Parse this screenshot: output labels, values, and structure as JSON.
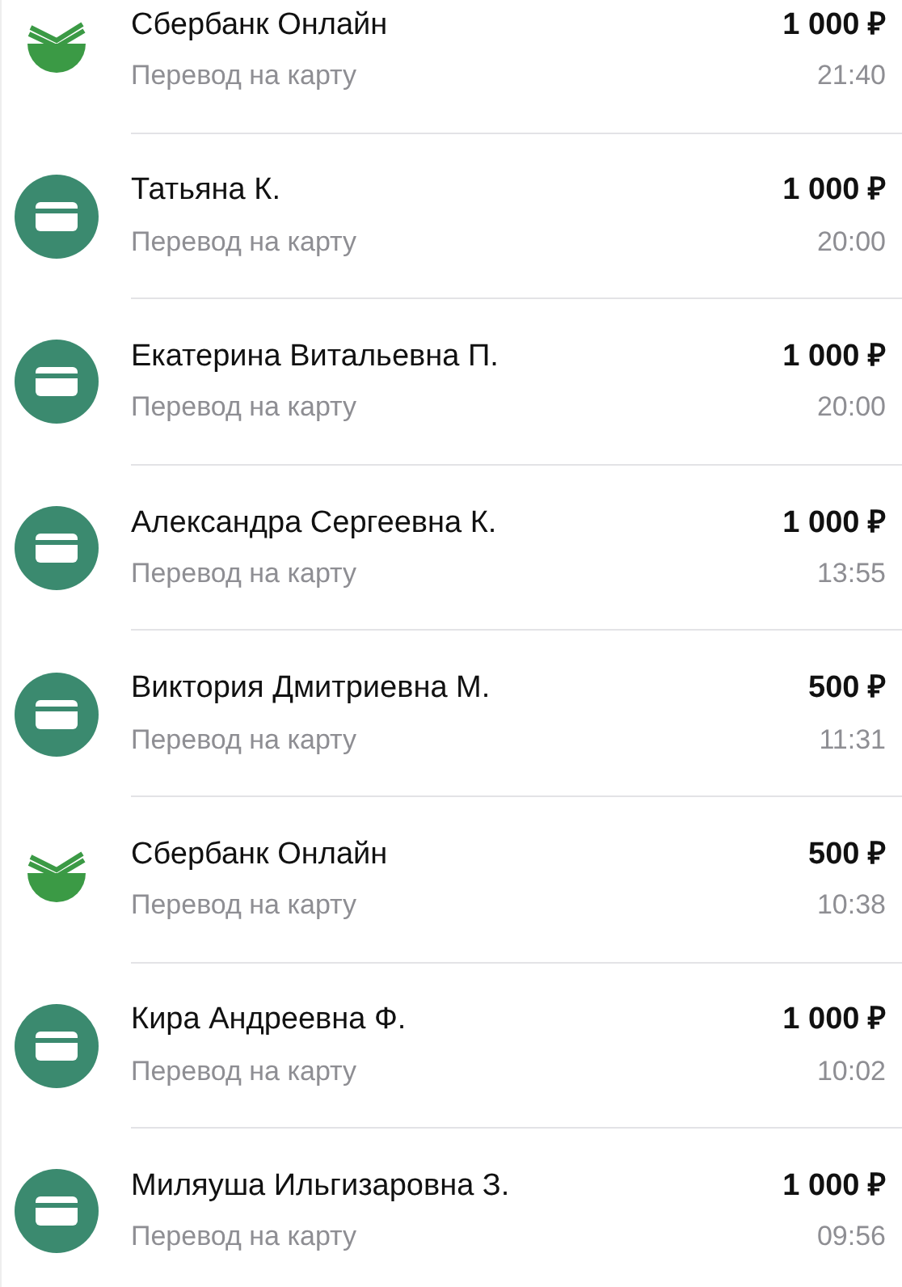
{
  "transactions": [
    {
      "kind": "bank",
      "name": "Сбербанк Онлайн",
      "subtitle": "Перевод на карту",
      "amount": "1 000 ₽",
      "time": "21:40"
    },
    {
      "kind": "card",
      "name": "Татьяна К.",
      "subtitle": "Перевод на карту",
      "amount": "1 000 ₽",
      "time": "20:00"
    },
    {
      "kind": "card",
      "name": "Екатерина Витальевна П.",
      "subtitle": "Перевод на карту",
      "amount": "1 000 ₽",
      "time": "20:00"
    },
    {
      "kind": "card",
      "name": "Александра Сергеевна К.",
      "subtitle": "Перевод на карту",
      "amount": "1 000 ₽",
      "time": "13:55"
    },
    {
      "kind": "card",
      "name": "Виктория Дмитриевна М.",
      "subtitle": "Перевод на карту",
      "amount": "500 ₽",
      "time": "11:31"
    },
    {
      "kind": "bank",
      "name": "Сбербанк Онлайн",
      "subtitle": "Перевод на карту",
      "amount": "500 ₽",
      "time": "10:38"
    },
    {
      "kind": "card",
      "name": "Кира Андреевна Ф.",
      "subtitle": "Перевод на карту",
      "amount": "1 000 ₽",
      "time": "10:02"
    },
    {
      "kind": "card",
      "name": "Миляуша Ильгизаровна З.",
      "subtitle": "Перевод на карту",
      "amount": "1 000 ₽",
      "time": "09:56"
    }
  ]
}
